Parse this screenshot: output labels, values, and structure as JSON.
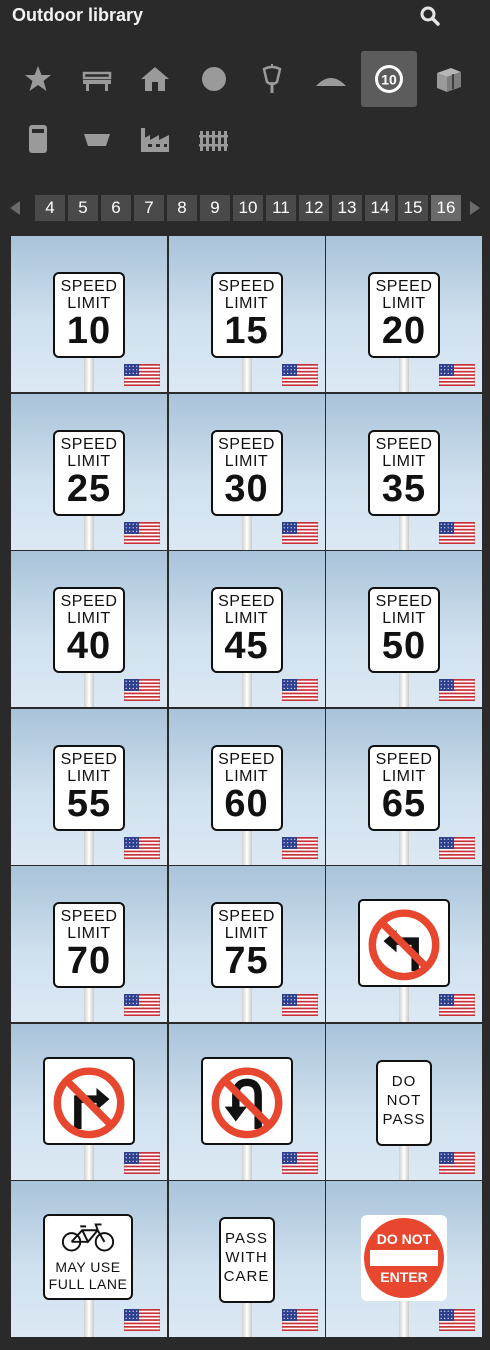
{
  "header": {
    "title": "Outdoor library"
  },
  "categories": [
    {
      "icon": "star-icon",
      "selected": false
    },
    {
      "icon": "bench-icon",
      "selected": false
    },
    {
      "icon": "house-icon",
      "selected": false
    },
    {
      "icon": "circle-icon",
      "selected": false
    },
    {
      "icon": "lantern-icon",
      "selected": false
    },
    {
      "icon": "mound-icon",
      "selected": false
    },
    {
      "icon": "road-sign-10-icon",
      "selected": true,
      "label": "10"
    },
    {
      "icon": "box-icon",
      "selected": false
    },
    {
      "icon": "cabinet-icon",
      "selected": false
    },
    {
      "icon": "planter-icon",
      "selected": false
    },
    {
      "icon": "factory-icon",
      "selected": false
    },
    {
      "icon": "fence-icon",
      "selected": false
    }
  ],
  "pagination": {
    "pages": [
      "4",
      "5",
      "6",
      "7",
      "8",
      "9",
      "10",
      "11",
      "12",
      "13",
      "14",
      "15",
      "16"
    ],
    "active": "16"
  },
  "tiles": [
    {
      "type": "speed",
      "l1": "SPEED",
      "l2": "LIMIT",
      "num": "10"
    },
    {
      "type": "speed",
      "l1": "SPEED",
      "l2": "LIMIT",
      "num": "15"
    },
    {
      "type": "speed",
      "l1": "SPEED",
      "l2": "LIMIT",
      "num": "20"
    },
    {
      "type": "speed",
      "l1": "SPEED",
      "l2": "LIMIT",
      "num": "25"
    },
    {
      "type": "speed",
      "l1": "SPEED",
      "l2": "LIMIT",
      "num": "30"
    },
    {
      "type": "speed",
      "l1": "SPEED",
      "l2": "LIMIT",
      "num": "35"
    },
    {
      "type": "speed",
      "l1": "SPEED",
      "l2": "LIMIT",
      "num": "40"
    },
    {
      "type": "speed",
      "l1": "SPEED",
      "l2": "LIMIT",
      "num": "45"
    },
    {
      "type": "speed",
      "l1": "SPEED",
      "l2": "LIMIT",
      "num": "50"
    },
    {
      "type": "speed",
      "l1": "SPEED",
      "l2": "LIMIT",
      "num": "55"
    },
    {
      "type": "speed",
      "l1": "SPEED",
      "l2": "LIMIT",
      "num": "60"
    },
    {
      "type": "speed",
      "l1": "SPEED",
      "l2": "LIMIT",
      "num": "65"
    },
    {
      "type": "speed",
      "l1": "SPEED",
      "l2": "LIMIT",
      "num": "70"
    },
    {
      "type": "speed",
      "l1": "SPEED",
      "l2": "LIMIT",
      "num": "75"
    },
    {
      "type": "no-left-turn"
    },
    {
      "type": "no-right-turn"
    },
    {
      "type": "no-u-turn"
    },
    {
      "type": "text",
      "lines": [
        "DO",
        "NOT",
        "PASS"
      ]
    },
    {
      "type": "bike",
      "lines": [
        "MAY USE",
        "FULL LANE"
      ]
    },
    {
      "type": "text",
      "lines": [
        "PASS",
        "WITH",
        "CARE"
      ]
    },
    {
      "type": "do-not-enter",
      "lines": [
        "DO NOT",
        "ENTER"
      ]
    }
  ],
  "colors": {
    "background": "#2a2a2a",
    "accent_red": "#e8472f",
    "icon_gray": "#9a9a9a"
  }
}
